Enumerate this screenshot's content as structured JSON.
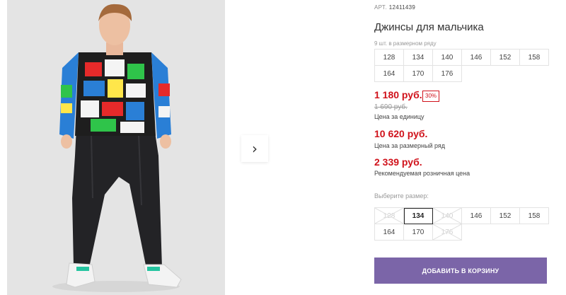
{
  "product": {
    "sku_label": "АРТ.",
    "sku": "12411439",
    "title": "Джинсы для мальчика",
    "image_alt": "boy in printed sweatshirt and dark jeans"
  },
  "gallery": {
    "next_icon": "chevron-right-icon"
  },
  "pack": {
    "note": "9 шт. в размерном ряду",
    "sizes": [
      "128",
      "134",
      "140",
      "146",
      "152",
      "158",
      "164",
      "170",
      "176"
    ]
  },
  "prices": {
    "current": "1 180 руб.",
    "discount": "30%",
    "old": "1 690 руб.",
    "unit_label": "Цена за единицу",
    "row_price": "10 620 руб.",
    "row_label": "Цена за размерный ряд",
    "rrp": "2 339 руб.",
    "rrp_label": "Рекомендуемая розничная цена"
  },
  "size_selector": {
    "label": "Выберите размер:",
    "sizes": [
      {
        "value": "128",
        "available": false,
        "selected": false
      },
      {
        "value": "134",
        "available": true,
        "selected": true
      },
      {
        "value": "140",
        "available": false,
        "selected": false
      },
      {
        "value": "146",
        "available": true,
        "selected": false
      },
      {
        "value": "152",
        "available": true,
        "selected": false
      },
      {
        "value": "158",
        "available": true,
        "selected": false
      },
      {
        "value": "164",
        "available": true,
        "selected": false
      },
      {
        "value": "170",
        "available": true,
        "selected": false
      },
      {
        "value": "176",
        "available": false,
        "selected": false
      }
    ]
  },
  "cart": {
    "label": "ДОБАВИТЬ В КОРЗИНУ"
  },
  "colors": {
    "accent": "#7b65a8",
    "price": "#d0121b",
    "border": "#e3e3e3",
    "photo_bg": "#e4e4e4"
  }
}
